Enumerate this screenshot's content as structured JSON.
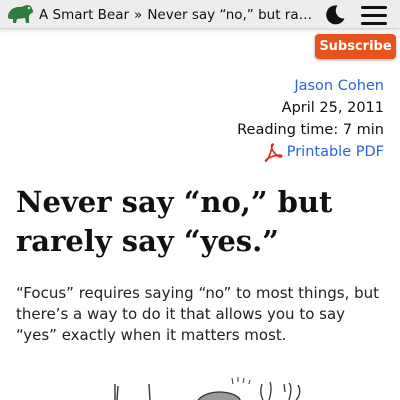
{
  "header": {
    "site_name": "A Smart Bear",
    "separator": "»",
    "current_page": "Never say “no,” but rarely say “yes.”",
    "logo_icon": "bear-logo-icon",
    "theme_icon": "moon-icon",
    "menu_icon": "hamburger-menu-icon"
  },
  "subscribe_label": "Subscribe",
  "meta": {
    "author": "Jason Cohen",
    "date": "April 25, 2011",
    "reading_time": "Reading time: 7 min",
    "pdf_label": "Printable PDF",
    "pdf_icon": "pdf-icon"
  },
  "article": {
    "title": "Never say “no,” but rarely say “yes.”",
    "lede": "“Focus” requires saying “no” to most things, but there’s a way to do it that allows you to say “yes” exactly when it matters most."
  },
  "colors": {
    "accent": "#e8531d",
    "link": "#2c63d6",
    "topbar_bg": "#ededed",
    "bear": "#2e7d3a"
  }
}
